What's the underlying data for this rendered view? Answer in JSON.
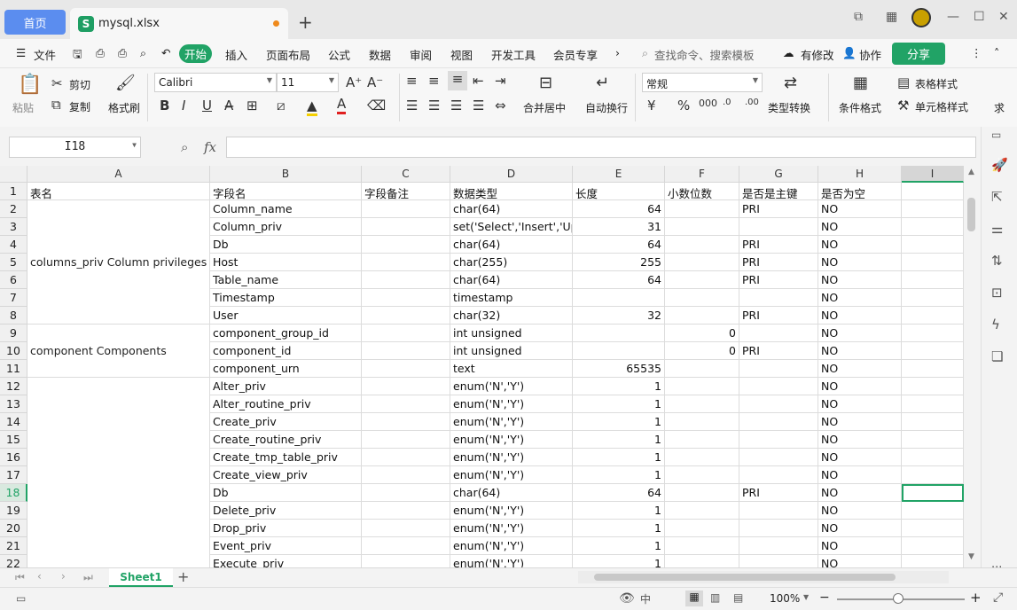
{
  "tabs": {
    "home": "首页",
    "file": "mysql.xlsx",
    "new_tab": "+"
  },
  "menu": {
    "file": "文件",
    "items": [
      "开始",
      "插入",
      "页面布局",
      "公式",
      "数据",
      "审阅",
      "视图",
      "开发工具",
      "会员专享"
    ],
    "search_placeholder": "查找命令、搜索模板",
    "modified": "有修改",
    "collab": "协作",
    "share": "分享"
  },
  "ribbon": {
    "paste": "粘贴",
    "cut": "剪切",
    "copy": "复制",
    "format_painter": "格式刷",
    "font": "Calibri",
    "size": "11",
    "merge": "合并居中",
    "wrap": "自动换行",
    "number_format": "常规",
    "type_convert": "类型转换",
    "cond_format": "条件格式",
    "table_style": "表格样式",
    "cell_style": "单元格样式",
    "more": "求"
  },
  "formula": {
    "namebox": "I18",
    "fx": "fx",
    "value": ""
  },
  "columns": [
    "A",
    "B",
    "C",
    "D",
    "E",
    "F",
    "G",
    "H",
    "I"
  ],
  "headers": [
    "表名",
    "字段名",
    "字段备注",
    "数据类型",
    "长度",
    "小数位数",
    "是否是主键",
    "是否为空"
  ],
  "groups": [
    {
      "label": "columns_priv Column privileges",
      "from": 2,
      "to": 8
    },
    {
      "label": "component Components",
      "from": 9,
      "to": 11
    },
    {
      "label": "",
      "from": 12,
      "to": 22
    }
  ],
  "rows": [
    {
      "n": "2",
      "b": "Column_name",
      "d": "char(64)",
      "e": "64",
      "f": "",
      "g": "PRI",
      "h": "NO"
    },
    {
      "n": "3",
      "b": "Column_priv",
      "d": "set('Select','Insert','Up",
      "e": "31",
      "f": "",
      "g": "",
      "h": "NO"
    },
    {
      "n": "4",
      "b": "Db",
      "d": "char(64)",
      "e": "64",
      "f": "",
      "g": "PRI",
      "h": "NO"
    },
    {
      "n": "5",
      "b": "Host",
      "d": "char(255)",
      "e": "255",
      "f": "",
      "g": "PRI",
      "h": "NO"
    },
    {
      "n": "6",
      "b": "Table_name",
      "d": "char(64)",
      "e": "64",
      "f": "",
      "g": "PRI",
      "h": "NO"
    },
    {
      "n": "7",
      "b": "Timestamp",
      "d": "timestamp",
      "e": "",
      "f": "",
      "g": "",
      "h": "NO"
    },
    {
      "n": "8",
      "b": "User",
      "d": "char(32)",
      "e": "32",
      "f": "",
      "g": "PRI",
      "h": "NO"
    },
    {
      "n": "9",
      "b": "component_group_id",
      "d": "int unsigned",
      "e": "",
      "f": "0",
      "g": "",
      "h": "NO"
    },
    {
      "n": "10",
      "b": "component_id",
      "d": "int unsigned",
      "e": "",
      "f": "0",
      "g": "PRI",
      "h": "NO"
    },
    {
      "n": "11",
      "b": "component_urn",
      "d": "text",
      "e": "65535",
      "f": "",
      "g": "",
      "h": "NO"
    },
    {
      "n": "12",
      "b": "Alter_priv",
      "d": "enum('N','Y')",
      "e": "1",
      "f": "",
      "g": "",
      "h": "NO"
    },
    {
      "n": "13",
      "b": "Alter_routine_priv",
      "d": "enum('N','Y')",
      "e": "1",
      "f": "",
      "g": "",
      "h": "NO"
    },
    {
      "n": "14",
      "b": "Create_priv",
      "d": "enum('N','Y')",
      "e": "1",
      "f": "",
      "g": "",
      "h": "NO"
    },
    {
      "n": "15",
      "b": "Create_routine_priv",
      "d": "enum('N','Y')",
      "e": "1",
      "f": "",
      "g": "",
      "h": "NO"
    },
    {
      "n": "16",
      "b": "Create_tmp_table_priv",
      "d": "enum('N','Y')",
      "e": "1",
      "f": "",
      "g": "",
      "h": "NO"
    },
    {
      "n": "17",
      "b": "Create_view_priv",
      "d": "enum('N','Y')",
      "e": "1",
      "f": "",
      "g": "",
      "h": "NO"
    },
    {
      "n": "18",
      "b": "Db",
      "d": "char(64)",
      "e": "64",
      "f": "",
      "g": "PRI",
      "h": "NO"
    },
    {
      "n": "19",
      "b": "Delete_priv",
      "d": "enum('N','Y')",
      "e": "1",
      "f": "",
      "g": "",
      "h": "NO"
    },
    {
      "n": "20",
      "b": "Drop_priv",
      "d": "enum('N','Y')",
      "e": "1",
      "f": "",
      "g": "",
      "h": "NO"
    },
    {
      "n": "21",
      "b": "Event_priv",
      "d": "enum('N','Y')",
      "e": "1",
      "f": "",
      "g": "",
      "h": "NO"
    },
    {
      "n": "22",
      "b": "Execute_priv",
      "d": "enum('N','Y')",
      "e": "1",
      "f": "",
      "g": "",
      "h": "NO"
    }
  ],
  "active_row": "18",
  "active_col": "I",
  "sheet": {
    "name": "Sheet1"
  },
  "status": {
    "zoom": "100%"
  },
  "colors": {
    "accent": "#21a366",
    "home_tab": "#5b8def",
    "modified_dot": "#ef8a1c"
  }
}
